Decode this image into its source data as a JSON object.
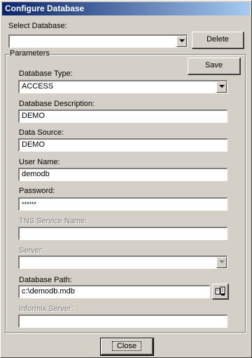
{
  "window": {
    "title": "Configure Database"
  },
  "select_database": {
    "label": "Select Database:",
    "value": ""
  },
  "buttons": {
    "delete_label": "Delete",
    "save_label": "Save",
    "close_label": "Close"
  },
  "parameters": {
    "caption": "Parameters",
    "database_type": {
      "label": "Database Type:",
      "value": "ACCESS"
    },
    "database_description": {
      "label": "Database Description:",
      "value": "DEMO"
    },
    "data_source": {
      "label": "Data Source:",
      "value": "DEMO"
    },
    "user_name": {
      "label": "User Name:",
      "value": "demodb"
    },
    "password": {
      "label": "Password:",
      "value": "******"
    },
    "tns_service_name": {
      "label": "TNS Service Name:",
      "value": ""
    },
    "server": {
      "label": "Server:",
      "value": ""
    },
    "database_path": {
      "label": "Database Path:",
      "value": "c:\\demodb.mdb"
    },
    "informix_server": {
      "label": "Informix Server:",
      "value": ""
    }
  },
  "icons": {
    "browse": "browse-folder-icon",
    "dropdown": "chevron-down-icon"
  },
  "colors": {
    "titlebar_start": "#0a246a",
    "titlebar_end": "#a6caf0",
    "face": "#d4d0c8"
  }
}
